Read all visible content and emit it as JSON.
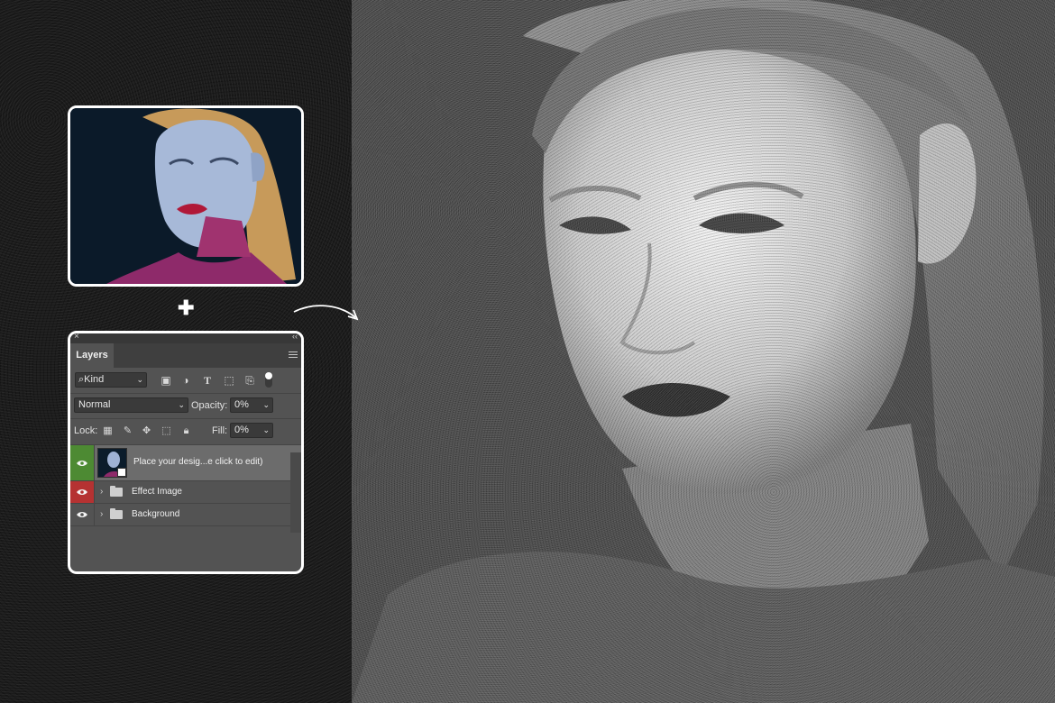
{
  "layers_panel": {
    "tab_label": "Layers",
    "filter_kind": "Kind",
    "blend_mode": "Normal",
    "opacity_label": "Opacity:",
    "opacity_value": "0%",
    "lock_label": "Lock:",
    "fill_label": "Fill:",
    "fill_value": "0%",
    "layers": [
      {
        "name": "Place your desig...e click to edit)",
        "type": "smart-object",
        "visibility_color": "#4d8a33",
        "selected": true
      },
      {
        "name": "Effect Image",
        "type": "group",
        "visibility_color": "#b53232",
        "selected": false
      },
      {
        "name": "Background",
        "type": "group",
        "visibility_color": "none",
        "selected": false
      }
    ]
  },
  "icons": {
    "plus": "plus-icon",
    "arrow": "curved-arrow-icon",
    "filter_icons": [
      "image-filter-icon",
      "adjustment-filter-icon",
      "type-filter-icon",
      "shape-filter-icon",
      "smart-object-filter-icon"
    ],
    "lock_icons": [
      "lock-transparent-icon",
      "lock-image-icon",
      "lock-position-icon",
      "lock-artboard-icon",
      "lock-all-icon"
    ]
  },
  "colors": {
    "background": "#1c1c1c",
    "panel": "#535353",
    "selected_layer": "#6c6c6c",
    "eye_green": "#4d8a33",
    "eye_red": "#b53232",
    "card_border": "#ffffff"
  }
}
